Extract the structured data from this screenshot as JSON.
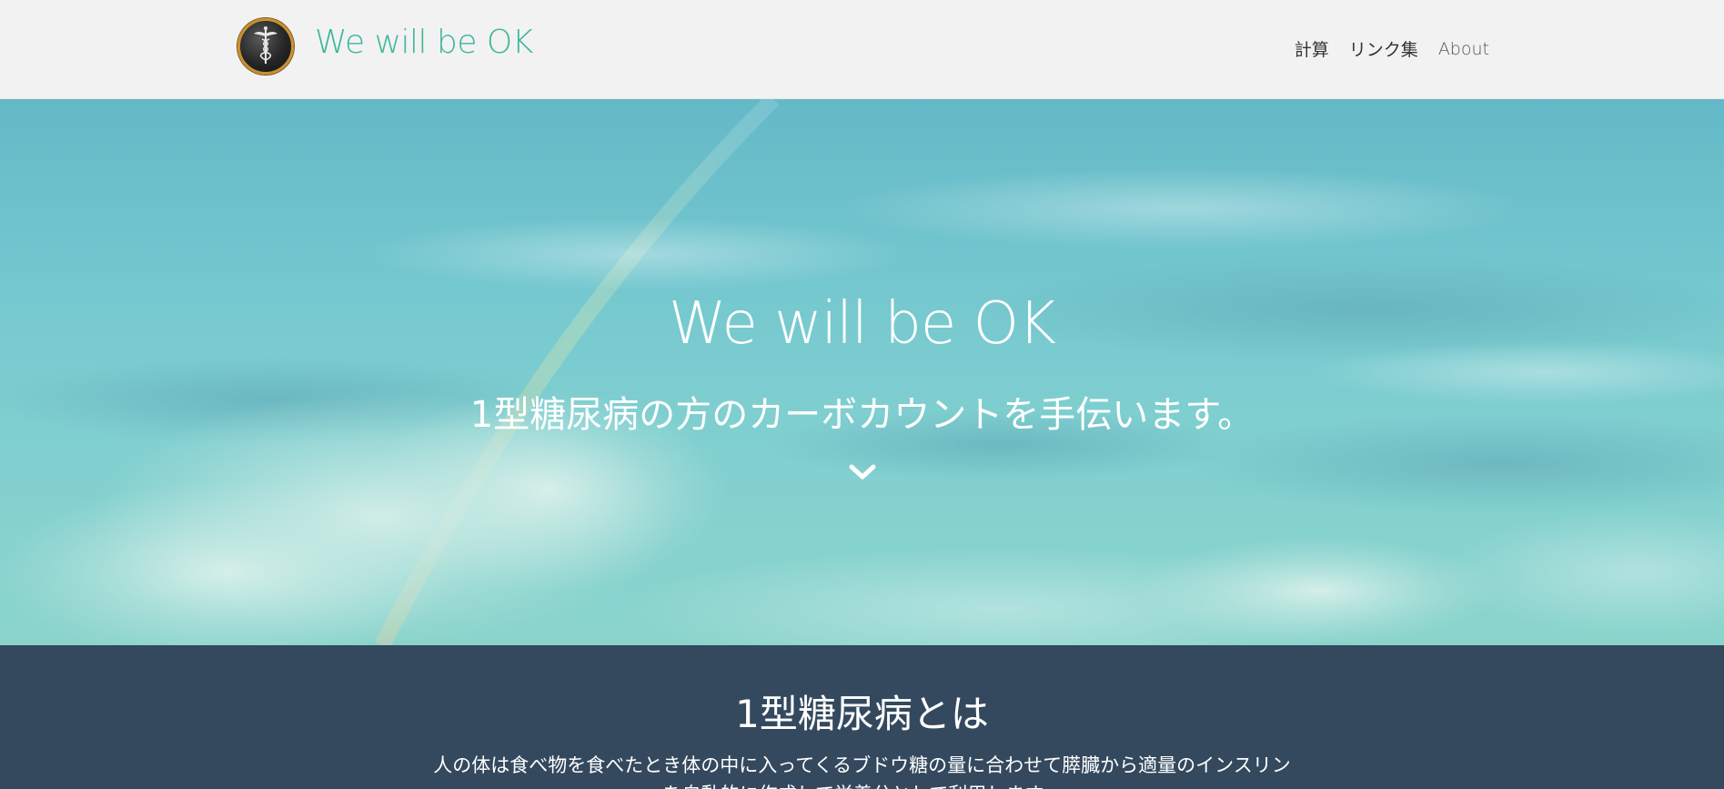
{
  "header": {
    "brand": "We will be OK",
    "nav": {
      "calc": "計算",
      "links": "リンク集",
      "about": "About"
    }
  },
  "hero": {
    "title": "We will be OK",
    "subtitle": "1型糖尿病の方のカーボカウントを手伝います。",
    "scroll_icon": "chevron-down-icon"
  },
  "about": {
    "title": "1型糖尿病とは",
    "text": "人の体は食べ物を食べたとき体の中に入ってくるブドウ糖の量に合わせて膵臓から適量のインスリンを自動的に作成して栄養分として利用します。"
  },
  "colors": {
    "brand": "#3fb79a",
    "header_bg": "#f2f2f2",
    "section_bg": "#34495e",
    "logo_ring": "#c8902e"
  },
  "icons": {
    "logo": "caduceus-logo-icon"
  }
}
